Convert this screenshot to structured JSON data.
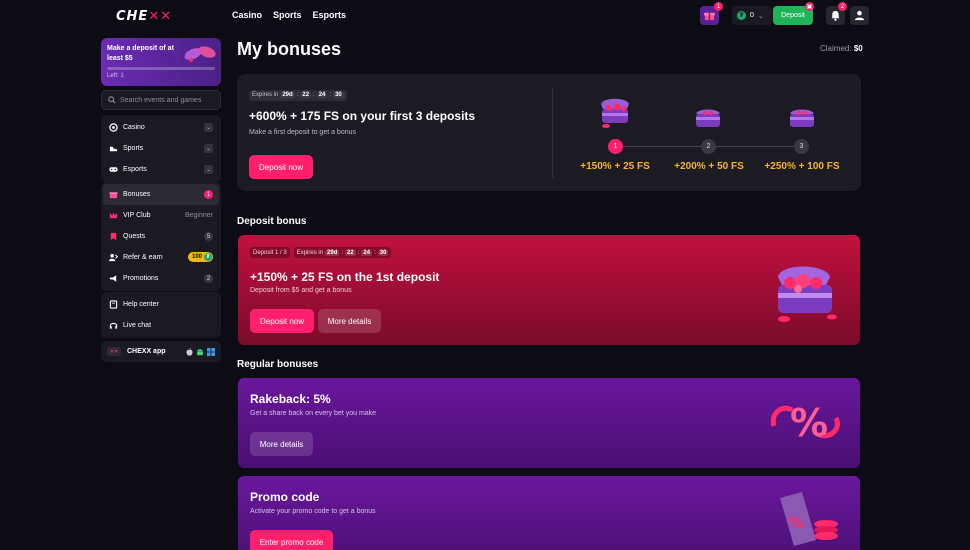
{
  "header": {
    "logo": "CHEXX",
    "nav": [
      "Casino",
      "Sports",
      "Esports"
    ],
    "gift_badge": "1",
    "balance": "0",
    "deposit_label": "Deposit",
    "notifications_badge": "2"
  },
  "sidebar": {
    "promo": {
      "text": "Make a deposit of at least $5",
      "left": "Left: 1"
    },
    "search_placeholder": "Search events and games",
    "games": [
      {
        "label": "Casino"
      },
      {
        "label": "Sports"
      },
      {
        "label": "Esports"
      }
    ],
    "menu": [
      {
        "label": "Bonuses",
        "count": "1"
      },
      {
        "label": "VIP Club",
        "status": "Beginner"
      },
      {
        "label": "Quests",
        "count": "5"
      },
      {
        "label": "Refer & earn",
        "reward": "100"
      },
      {
        "label": "Promotions",
        "count": "2"
      }
    ],
    "support": [
      {
        "label": "Help center"
      },
      {
        "label": "Live chat"
      }
    ],
    "app": {
      "label": "CHEXX app"
    }
  },
  "main": {
    "title": "My bonuses",
    "claimed_label": "Claimed:",
    "claimed_value": "$0",
    "welcome": {
      "expires_label": "Expires in",
      "timer": [
        "29d",
        "22",
        "24",
        "30"
      ],
      "title": "+600% + 175 FS on your first 3 deposits",
      "subtitle": "Make a first deposit to get a bonus",
      "button": "Deposit now",
      "steps": [
        {
          "num": "1",
          "label": "+150% + 25 FS"
        },
        {
          "num": "2",
          "label": "+200% + 50 FS"
        },
        {
          "num": "3",
          "label": "+250% + 100 FS"
        }
      ]
    },
    "deposit_section": {
      "title": "Deposit bonus",
      "step_chip": "Deposit 1 / 3",
      "expires_label": "Expires in",
      "timer": [
        "29d",
        "22",
        "24",
        "30"
      ],
      "card_title": "+150% + 25 FS on the 1st deposit",
      "card_subtitle": "Deposit from $5 and get a bonus",
      "primary_button": "Deposit now",
      "secondary_button": "More details"
    },
    "regular_section": {
      "title": "Regular bonuses",
      "rakeback": {
        "title": "Rakeback: 5%",
        "subtitle": "Get a share back on every bet you make",
        "button": "More details"
      },
      "promo": {
        "title": "Promo code",
        "subtitle": "Activate your promo code to get a bonus",
        "button": "Enter promo code"
      }
    }
  },
  "colors": {
    "accent": "#ff1f6d",
    "gold": "#f7b528",
    "green": "#1fb35a",
    "purple": "#6a179c"
  }
}
